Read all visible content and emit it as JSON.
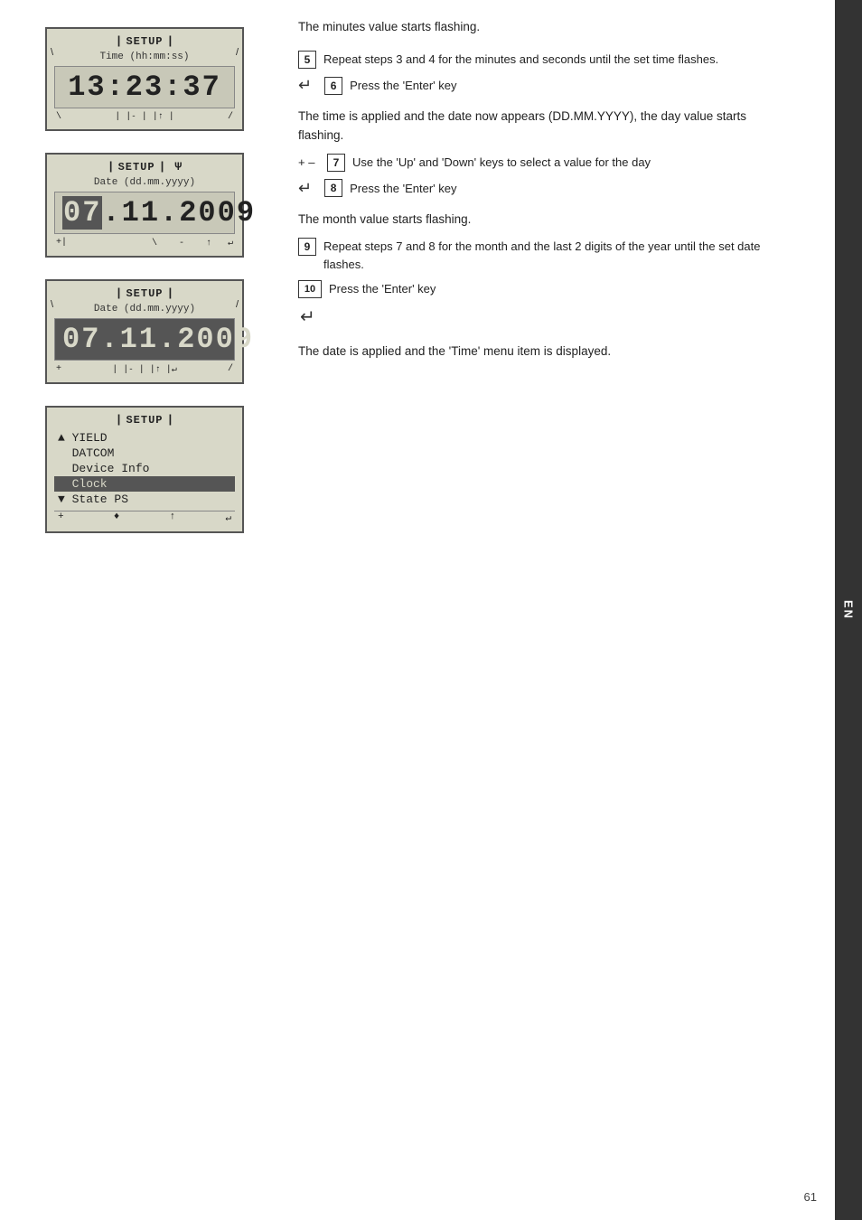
{
  "page": {
    "number": "61",
    "sidebar_label": "EN"
  },
  "screens": [
    {
      "id": "screen1",
      "title": "SETUP",
      "subtitle": "Time (hh:mm:ss)",
      "big_value": "13:23:37",
      "corner_tl": "\\",
      "corner_tr": "/",
      "corner_bl": "+",
      "corner_br": "↑",
      "bottom_row": "| |- | |↑ |"
    },
    {
      "id": "screen2",
      "title": "SETUP",
      "subtitle": "Date (dd.mm.yyyy)",
      "big_value_prefix": "07",
      "big_value_suffix": ".11.2009",
      "inverted": true,
      "corner_tl": "\\",
      "battery": "Ψ",
      "corner_bl": "+|",
      "corner_br": "↑ ↵"
    },
    {
      "id": "screen3",
      "title": "SETUP",
      "subtitle": "Date (dd.mm.yyyy)",
      "big_value": "07.11.2009",
      "inverted_last": true,
      "corner_tl": "\\",
      "corner_tr": "/",
      "corner_bl": "+",
      "bottom_row": "| |- | |↑ |↵"
    },
    {
      "id": "screen4_menu",
      "title": "SETUP",
      "items": [
        "▲ YIELD",
        "  DATCOM",
        "  Device Info",
        "  Clock",
        "▼ State PS"
      ],
      "selected_index": 3,
      "bottom_row": "+ ♦ ↑ ↵"
    }
  ],
  "instructions": {
    "intro_text": "The minutes value starts flashing.",
    "steps": [
      {
        "id": "step5",
        "number": "5",
        "has_enter_prefix": false,
        "text": "Repeat steps 3 and 4 for the minutes and seconds until the set time flashes."
      },
      {
        "id": "step6",
        "number": "6",
        "has_enter_prefix": true,
        "text": "Press the 'Enter' key"
      }
    ],
    "middle_text": "The time is applied and the date now appears (DD.MM.YYYY), the day value starts flashing.",
    "steps2": [
      {
        "id": "step7",
        "number": "7",
        "has_plus_minus": true,
        "text": "Use the 'Up' and 'Down' keys to select a value for the day"
      },
      {
        "id": "step8",
        "number": "8",
        "has_enter_prefix": true,
        "text": "Press the 'Enter' key"
      }
    ],
    "middle_text2": "The month value starts flashing.",
    "steps3": [
      {
        "id": "step9",
        "number": "9",
        "text": "Repeat steps 7 and 8 for the month and the last 2 digits of the year until the set date flashes."
      },
      {
        "id": "step10",
        "number": "10",
        "has_enter_prefix": true,
        "text": "Press the 'Enter' key"
      }
    ],
    "enter_icon_step10": "↵",
    "final_text": "The date is applied and the 'Time' menu item is displayed."
  }
}
